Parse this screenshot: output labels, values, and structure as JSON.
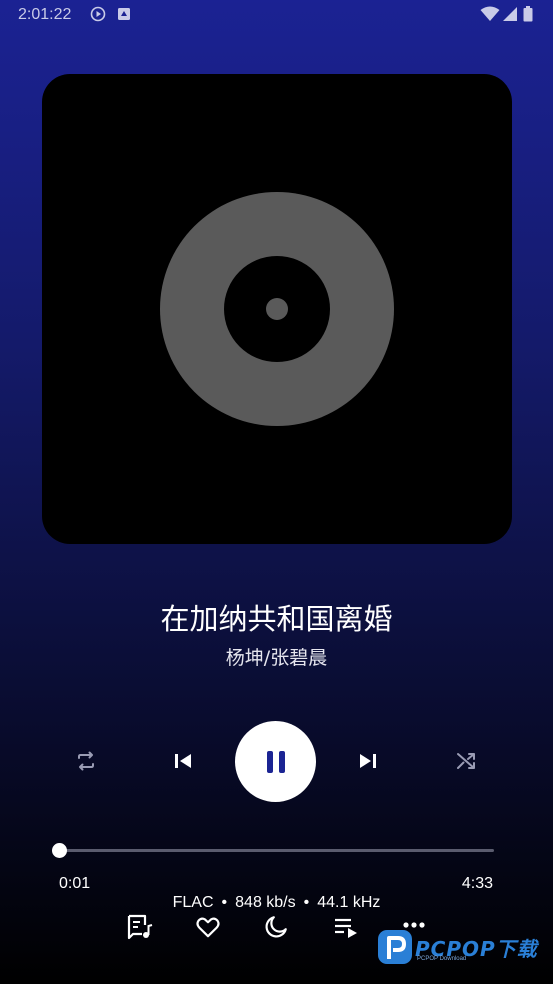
{
  "status_bar": {
    "time": "2:01:22",
    "left_icons": [
      "play-circle-icon",
      "android-icon"
    ],
    "right_icons": [
      "wifi-icon",
      "signal-icon",
      "battery-icon"
    ]
  },
  "player": {
    "song_title": "在加纳共和国离婚",
    "artist": "杨坤/张碧晨",
    "progress_fraction": 0.0037,
    "time_elapsed": "0:01",
    "time_total": "4:33",
    "format": "FLAC",
    "bitrate": "848 kb/s",
    "sample_rate": "44.1 kHz",
    "separator": "•"
  },
  "controls": [
    "repeat-icon",
    "previous-icon",
    "pause-icon",
    "next-icon",
    "shuffle-icon"
  ],
  "bottom_bar": [
    "lyrics-icon",
    "favorite-icon",
    "sleep-timer-icon",
    "queue-icon",
    "more-icon"
  ],
  "watermark": {
    "text": "PCPOP下载",
    "subtext": "PCPOP Download"
  },
  "colors": {
    "background_top": "#1b2293",
    "background_bottom": "#000000",
    "accent": "#1b2493",
    "disc": "#5a5a5a",
    "watermark": "#2a7fd6"
  }
}
